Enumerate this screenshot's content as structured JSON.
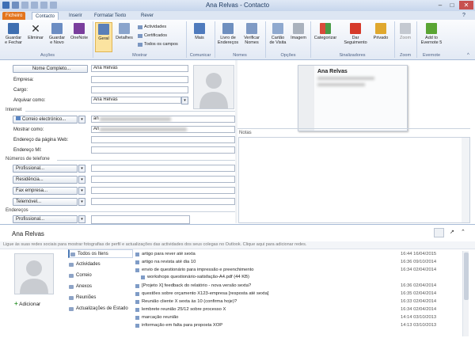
{
  "window": {
    "title": "Ana Relvas - Contacto",
    "title_name": "Ana Relvas",
    "title_sep": "-",
    "title_type": "Contacto",
    "min": "–",
    "max": "□",
    "close": "✕"
  },
  "tabs": [
    "Ficheiro",
    "Contacto",
    "Inserir",
    "Formatar Texto",
    "Rever"
  ],
  "ribbon": {
    "acoes": {
      "label": "Acções",
      "save_close": "Guardar\ne Fechar",
      "delete": "Eliminar",
      "save_new": "Guardar\ne Novo",
      "onenote": "OneNote"
    },
    "mostrar": {
      "label": "Mostrar",
      "geral": "Geral",
      "detalhes": "Detalhes",
      "actividades": "Actividades",
      "certificados": "Certificados",
      "todos_campos": "Todos os campos"
    },
    "comunicar": {
      "label": "Comunicar",
      "mais": "Mais"
    },
    "nomes": {
      "label": "Nomes",
      "livro": "Livro de\nEndereços",
      "verificar": "Verificar\nNomes"
    },
    "opcoes": {
      "label": "Opções",
      "cartao": "Cartão\nde Visita",
      "imagem": "Imagem"
    },
    "sinalizadores": {
      "label": "Sinalizadores",
      "categorizar": "Categorizar",
      "dar_seguimento": "Dar\nSeguimento",
      "privado": "Privado"
    },
    "zoom": {
      "label": "Zoom",
      "zoom": "Zoom"
    },
    "evernote": {
      "label": "Evernote",
      "add": "Add to\nEvernote 5"
    }
  },
  "form": {
    "nome_btn": "Nome Completo...",
    "nome_val": "Ana Relvas",
    "empresa": "Empresa:",
    "cargo": "Cargo:",
    "arquivar": "Arquivar como:",
    "arquivar_val": "Ana Relvas",
    "internet": "Internet",
    "correio_btn": "Correio electrónico...",
    "correio_val": "an",
    "mostrar_como": "Mostrar como:",
    "mostrar_val": "An",
    "pagina_web": "Endereço da página Web:",
    "endereco_mi": "Endereço MI:",
    "numeros": "Números de telefone",
    "profissional": "Profissional...",
    "residencia": "Residência...",
    "fax": "Fax empresa...",
    "telemovel": "Telemóvel...",
    "enderecos": "Endereços",
    "profissional2": "Profissional...",
    "notas": "Notas",
    "card_name": "Ana Relvas"
  },
  "people": {
    "name": "Ana Relvas",
    "info": "Ligue às suas redes sociais para mostrar fotografias de perfil e actualizações das actividades dos seus colegas no Outlook. Clique aqui para adicionar redes.",
    "add": "Adicionar",
    "nav": [
      "Todos os Itens",
      "Actividades",
      "Correio",
      "Anexos",
      "Reuniões",
      "Actualizações de Estado"
    ],
    "items": [
      {
        "text": "artigo para rever até sexta",
        "date": "16:44 16/04/2015"
      },
      {
        "text": "artigo na revista até dia 10",
        "date": "16:36 09/10/2014"
      },
      {
        "text": "envio de questionário para impressão e preenchimento",
        "date": "16:34 02/04/2014"
      },
      {
        "text": "workshops questionário-satisfação-A4.pdf (44 KB)",
        "date": ""
      },
      {
        "text": "[Projeto X] feedback do relatório - nova versão sexta?",
        "date": "16:36 02/04/2014"
      },
      {
        "text": "questões sobre orçamento X123-empresa [resposta até sexta]",
        "date": "16:35 02/04/2014"
      },
      {
        "text": "Reunião cliente X sexta às 10 (confirma hoje)?",
        "date": "16:33 02/04/2014"
      },
      {
        "text": "lembrete reunião 25/12 sobre processo X",
        "date": "16:34 02/04/2014"
      },
      {
        "text": "marcação reunião",
        "date": "14:14 03/10/2013"
      },
      {
        "text": "informação em falta para proposta XOP",
        "date": "14:13 03/10/2013"
      }
    ]
  },
  "colors": {
    "file_tab": "#e3741d",
    "accent": "#4a78b5"
  }
}
